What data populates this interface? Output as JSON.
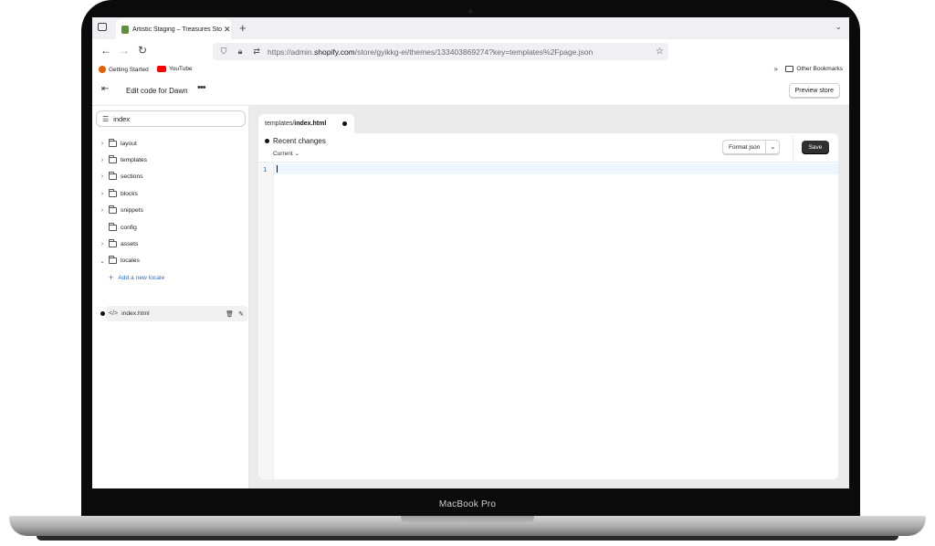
{
  "device": {
    "label": "MacBook Pro"
  },
  "browser": {
    "tab_title": "Artistic Staging – Treasures Stor",
    "url_host": "https://admin.shopify.com",
    "url_prefix": "https://admin.",
    "url_domain": "shopify.com",
    "url_path": "/store/gyikkg-ei/themes/133403869274?key=templates%2Fpage.json",
    "bookmarks": [
      {
        "label": "Getting Started",
        "icon": "firefox-icon",
        "color": "#e66000"
      },
      {
        "label": "YouTube",
        "icon": "youtube-icon",
        "color": "#ff0000"
      }
    ],
    "other_bookmarks": "Other Bookmarks"
  },
  "app": {
    "title": "Edit code for Dawn",
    "preview_label": "Preview store"
  },
  "sidebar": {
    "search_value": "index",
    "folders": [
      {
        "label": "layout",
        "expandable": true
      },
      {
        "label": "templates",
        "expandable": true
      },
      {
        "label": "sections",
        "expandable": true
      },
      {
        "label": "blocks",
        "expandable": true
      },
      {
        "label": "snippets",
        "expandable": true
      },
      {
        "label": "config",
        "expandable": false
      },
      {
        "label": "assets",
        "expandable": true
      },
      {
        "label": "locales",
        "expandable": true,
        "expanded": true
      }
    ],
    "add_locale_label": "Add a new locale",
    "open_file": "index.html"
  },
  "editor": {
    "tab_prefix": "templates/",
    "tab_file": "index.html",
    "recent_changes": "Recent changes",
    "current_label": "Current",
    "format_label": "Format json",
    "save_label": "Save",
    "line_numbers": [
      "1"
    ]
  },
  "colors": {
    "accent_link": "#2c6ecb",
    "save_bg": "#303030",
    "editor_bg": "#ebebeb"
  }
}
